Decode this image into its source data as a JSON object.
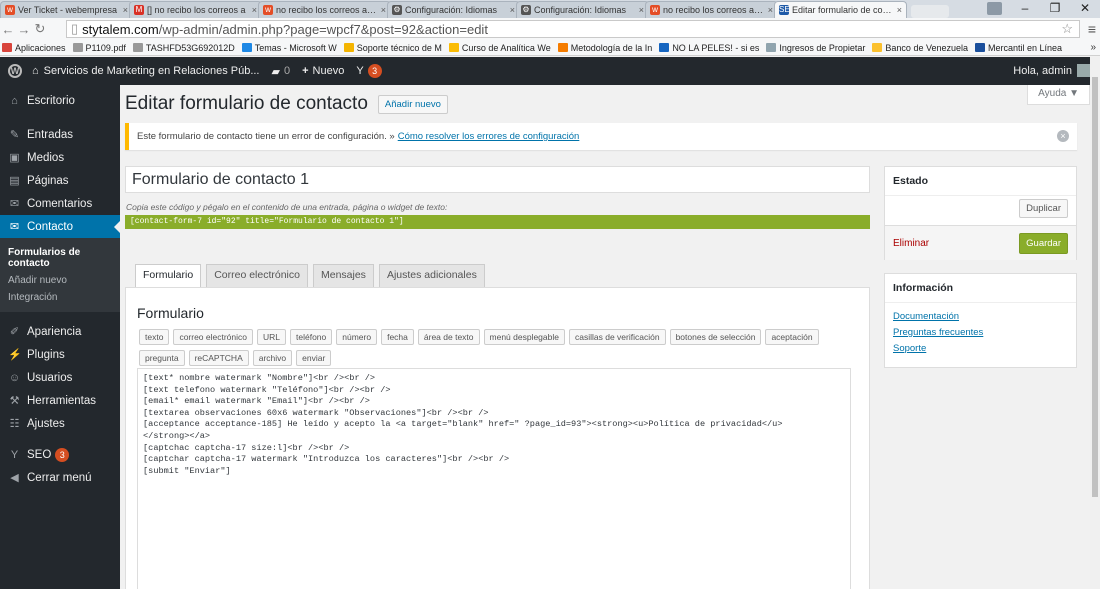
{
  "browser": {
    "tabs": [
      {
        "title": "Ver Ticket - webempresa",
        "icon": "w",
        "color": "#e44d26"
      },
      {
        "title": "[] no recibo los correos a",
        "icon": "M",
        "color": "#d93025"
      },
      {
        "title": "no recibo los correos a tra",
        "icon": "w",
        "color": "#e44d26"
      },
      {
        "title": "Configuración: Idiomas",
        "icon": "⚙",
        "color": "#555555"
      },
      {
        "title": "Configuración: Idiomas",
        "icon": "⚙",
        "color": "#555555"
      },
      {
        "title": "no recibo los correos a tra",
        "icon": "w",
        "color": "#e44d26"
      },
      {
        "title": "Editar formulario de conta",
        "icon": "SE",
        "color": "#1e5aa8"
      }
    ],
    "address": {
      "host": "stytalem.com",
      "path": "/wp-admin/admin.php?page=wpcf7&post=92&action=edit"
    },
    "bookmarks": [
      {
        "label": "Aplicaciones",
        "color": "#d8443c"
      },
      {
        "label": "P1109.pdf",
        "color": "#999999"
      },
      {
        "label": "TASHFD53G692012D",
        "color": "#999999"
      },
      {
        "label": "Temas - Microsoft W",
        "color": "#1e88e5"
      },
      {
        "label": "Soporte técnico de M",
        "color": "#f4b400"
      },
      {
        "label": "Curso de Analítica We",
        "color": "#fbbc05"
      },
      {
        "label": "Metodología de la In",
        "color": "#f57c00"
      },
      {
        "label": "NO LA PELES! - si es",
        "color": "#1565c0"
      },
      {
        "label": "Ingresos de Propietar",
        "color": "#90a4ae"
      },
      {
        "label": "Banco de Venezuela",
        "color": "#fbc02d"
      },
      {
        "label": "Mercantil en Línea",
        "color": "#1a4f9c"
      }
    ]
  },
  "adminbar": {
    "site": "Servicios de Marketing en Relaciones Púb...",
    "comments": "0",
    "new_label": "Nuevo",
    "seo_count": "3",
    "howdy": "Hola, admin"
  },
  "sidebar": {
    "items": [
      {
        "label": "Escritorio",
        "icon": "⌂"
      },
      {
        "label": "Entradas",
        "icon": "✎"
      },
      {
        "label": "Medios",
        "icon": "▣"
      },
      {
        "label": "Páginas",
        "icon": "▤"
      },
      {
        "label": "Comentarios",
        "icon": "✉"
      },
      {
        "label": "Contacto",
        "icon": "✉"
      }
    ],
    "submenu": [
      "Formularios de contacto",
      "Añadir nuevo",
      "Integración"
    ],
    "items2": [
      {
        "label": "Apariencia",
        "icon": "✐"
      },
      {
        "label": "Plugins",
        "icon": "⚡"
      },
      {
        "label": "Usuarios",
        "icon": "☺"
      },
      {
        "label": "Herramientas",
        "icon": "⚒"
      },
      {
        "label": "Ajustes",
        "icon": "☷"
      }
    ],
    "seo": {
      "label": "SEO",
      "count": "3"
    },
    "collapse": "Cerrar menú"
  },
  "main": {
    "help": "Ayuda ▼",
    "heading": "Editar formulario de contacto",
    "add_new": "Añadir nuevo",
    "notice_text": "Este formulario de contacto tiene un error de configuración. »",
    "notice_link": "Cómo resolver los errores de configuración",
    "form_title": "Formulario de contacto 1",
    "hint": "Copia este código y pégalo en el contenido de una entrada, página o widget de texto:",
    "shortcode": "[contact-form-7 id=\"92\" title=\"Formulario de contacto 1\"]",
    "tabs": [
      "Formulario",
      "Correo electrónico",
      "Mensajes",
      "Ajustes adicionales"
    ],
    "panel_title": "Formulario",
    "tag_buttons": [
      "texto",
      "correo electrónico",
      "URL",
      "teléfono",
      "número",
      "fecha",
      "área de texto",
      "menú desplegable",
      "casillas de verificación",
      "botones de selección",
      "aceptación",
      "pregunta",
      "reCAPTCHA",
      "archivo",
      "enviar"
    ],
    "code": "[text* nombre watermark \"Nombre\"]<br /><br />\n[text telefono watermark \"Teléfono\"]<br /><br />\n[email* email watermark \"Email\"]<br /><br />\n[textarea observaciones 60x6 watermark \"Observaciones\"]<br /><br />\n[acceptance acceptance-185] He leído y acepto la <a target=\"blank\" href=\" ?page_id=93\"><strong><u>Política de privacidad</u>\n</strong></a>\n[captchac captcha-17 size:l]<br /><br />\n[captchar captcha-17 watermark \"Introduzca los caracteres\"]<br /><br />\n[submit \"Enviar\"]"
  },
  "status_box": {
    "title": "Estado",
    "duplicate": "Duplicar",
    "delete": "Eliminar",
    "save": "Guardar"
  },
  "info_box": {
    "title": "Información",
    "links": [
      "Documentación",
      "Preguntas frecuentes",
      "Soporte"
    ]
  }
}
